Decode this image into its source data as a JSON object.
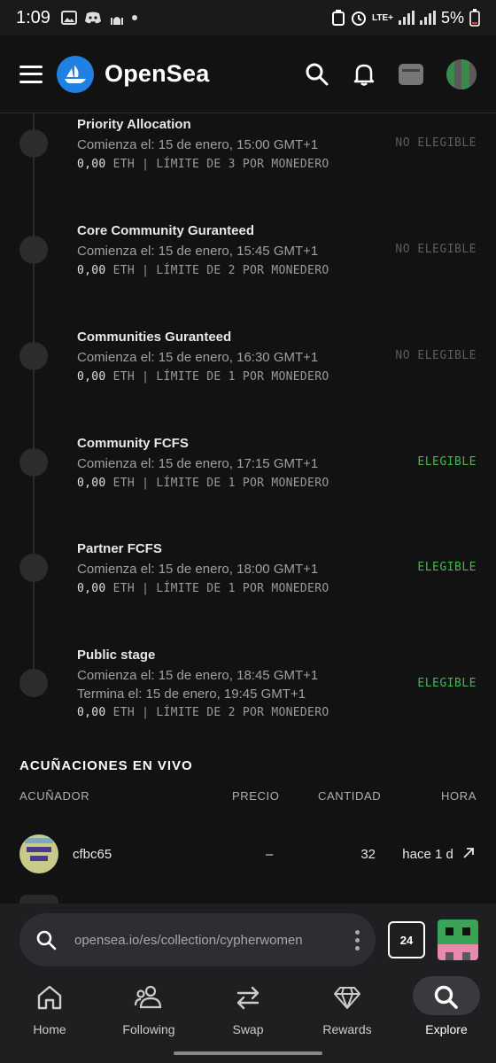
{
  "status_bar": {
    "time": "1:09",
    "network": "LTE+",
    "battery": "5%"
  },
  "header": {
    "brand": "OpenSea",
    "icons": [
      "menu-icon",
      "opensea-logo",
      "search-icon",
      "bell-icon",
      "wallet-icon",
      "profile-avatar"
    ]
  },
  "stages": [
    {
      "title": "Priority Allocation",
      "start": "Comienza el: 15 de enero, 15:00 GMT+1",
      "price_value": "0,00",
      "price_rest": " ETH | LÍMITE DE 3 POR MONEDERO",
      "status": "NO ELEGIBLE",
      "eligible": false
    },
    {
      "title": "Core Community Guranteed",
      "start": "Comienza el: 15 de enero, 15:45 GMT+1",
      "price_value": "0,00",
      "price_rest": " ETH | LÍMITE DE 2 POR MONEDERO",
      "status": "NO ELEGIBLE",
      "eligible": false
    },
    {
      "title": "Communities Guranteed",
      "start": "Comienza el: 15 de enero, 16:30 GMT+1",
      "price_value": "0,00",
      "price_rest": " ETH | LÍMITE DE 1 POR MONEDERO",
      "status": "NO ELEGIBLE",
      "eligible": false
    },
    {
      "title": "Community FCFS",
      "start": "Comienza el: 15 de enero, 17:15 GMT+1",
      "price_value": "0,00",
      "price_rest": " ETH | LÍMITE DE 1 POR MONEDERO",
      "status": "ELEGIBLE",
      "eligible": true
    },
    {
      "title": "Partner FCFS",
      "start": "Comienza el: 15 de enero, 18:00 GMT+1",
      "price_value": "0,00",
      "price_rest": " ETH | LÍMITE DE 1 POR MONEDERO",
      "status": "ELEGIBLE",
      "eligible": true
    },
    {
      "title": "Public stage",
      "start": "Comienza el: 15 de enero, 18:45 GMT+1",
      "end": "Termina el: 15 de enero, 19:45 GMT+1",
      "price_value": "0,00",
      "price_rest": " ETH | LÍMITE DE 2 POR MONEDERO",
      "status": "ELEGIBLE",
      "eligible": true
    }
  ],
  "live_mints": {
    "title": "ACUÑACIONES EN VIVO",
    "columns": [
      "ACUÑADOR",
      "PRECIO",
      "CANTIDAD",
      "HORA"
    ],
    "rows": [
      {
        "minter": "cfbc65",
        "price": "–",
        "quantity": "32",
        "time": "hace 1 d"
      }
    ]
  },
  "browser": {
    "url": "opensea.io/es/collection/cypherwomen",
    "tab_count": "24"
  },
  "bottom_nav": [
    {
      "label": "Home",
      "icon": "home-icon",
      "active": false
    },
    {
      "label": "Following",
      "icon": "people-icon",
      "active": false
    },
    {
      "label": "Swap",
      "icon": "swap-icon",
      "active": false
    },
    {
      "label": "Rewards",
      "icon": "diamond-icon",
      "active": false
    },
    {
      "label": "Explore",
      "icon": "search-icon",
      "active": true
    }
  ],
  "colors": {
    "background": "#121212",
    "eligible": "#3fb950",
    "not_eligible": "#5d5d5d",
    "brand_blue": "#2081e2"
  }
}
